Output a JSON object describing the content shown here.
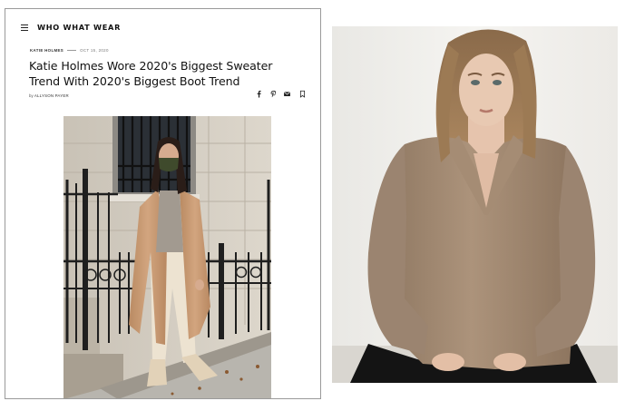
{
  "article": {
    "brand": "WHO WHAT WEAR",
    "category": "KATIE HOLMES",
    "date": "OCT 15, 2020",
    "headline_line1": "Katie Holmes Wore 2020's Biggest Sweater",
    "headline_line2": "Trend With 2020's Biggest Boot Trend",
    "byline_prefix": "by",
    "byline_author": "ALLYSON PAYER"
  },
  "icons": {
    "menu": "hamburger-menu-icon",
    "share": [
      "facebook-icon",
      "pinterest-icon",
      "email-icon",
      "bookmark-icon"
    ]
  },
  "colors": {
    "coat": "#c99a72",
    "sweater": "#a58c74",
    "railing": "#1f1f1f",
    "card_border": "#9a9a9a"
  }
}
